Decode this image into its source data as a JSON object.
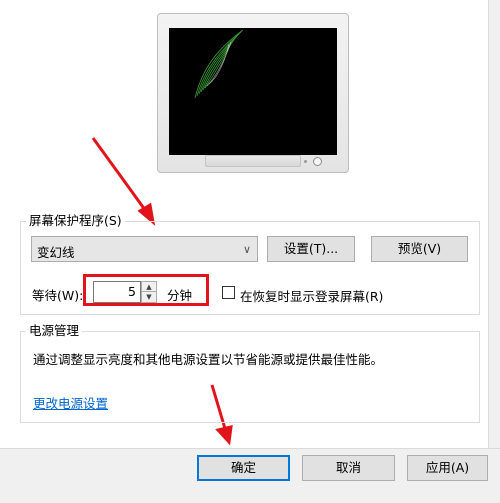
{
  "screensaver_group": {
    "title": "屏幕保护程序(S)",
    "selected_screensaver": "变幻线",
    "settings_button": "设置(T)...",
    "preview_button": "预览(V)",
    "wait_label": "等待(W):",
    "wait_value": "5",
    "wait_unit": "分钟",
    "resume_checkbox_label": "在恢复时显示登录屏幕(R)",
    "resume_checked": false
  },
  "power_group": {
    "title": "电源管理",
    "description": "通过调整显示亮度和其他电源设置以节省能源或提供最佳性能。",
    "link": "更改电源设置"
  },
  "footer": {
    "ok_button": "确定",
    "cancel_button": "取消",
    "apply_button": "应用(A)"
  },
  "annotation_color": "#e1141c",
  "accent_color": "#0078d7"
}
